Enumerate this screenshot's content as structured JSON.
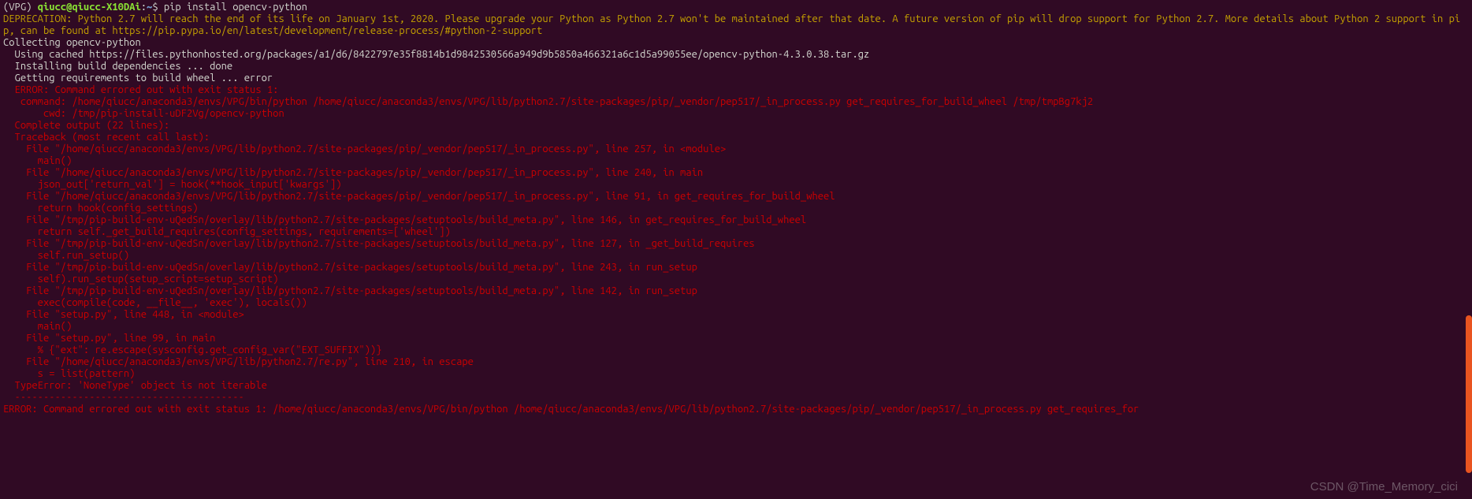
{
  "prompt": {
    "env": "(VPG) ",
    "user": "qiucc",
    "at": "@",
    "host": "qiucc-X10DAi",
    "colon": ":",
    "path": "~",
    "dollar": "$ "
  },
  "command": "pip install opencv-python",
  "deprecation": "DEPRECATION: Python 2.7 will reach the end of its life on January 1st, 2020. Please upgrade your Python as Python 2.7 won't be maintained after that date. A future version of pip will drop support for Python 2.7. More details about Python 2 support in pip, can be found at https://pip.pypa.io/en/latest/development/release-process/#python-2-support",
  "collecting": "Collecting opencv-python",
  "using_cached": "  Using cached https://files.pythonhosted.org/packages/a1/d6/8422797e35f8814b1d9842530566a949d9b5850a466321a6c1d5a99055ee/opencv-python-4.3.0.38.tar.gz",
  "installing_deps": "  Installing build dependencies ... done",
  "getting_reqs": "  Getting requirements to build wheel ... error",
  "err_header": "  ERROR: Command errored out with exit status 1:",
  "err_command": "   command: /home/qiucc/anaconda3/envs/VPG/bin/python /home/qiucc/anaconda3/envs/VPG/lib/python2.7/site-packages/pip/_vendor/pep517/_in_process.py get_requires_for_build_wheel /tmp/tmpBg7kj2",
  "err_cwd": "       cwd: /tmp/pip-install-uDF2Vg/opencv-python",
  "err_output": "  Complete output (22 lines):",
  "traceback_header": "  Traceback (most recent call last):",
  "tb": [
    "    File \"/home/qiucc/anaconda3/envs/VPG/lib/python2.7/site-packages/pip/_vendor/pep517/_in_process.py\", line 257, in <module>",
    "      main()",
    "    File \"/home/qiucc/anaconda3/envs/VPG/lib/python2.7/site-packages/pip/_vendor/pep517/_in_process.py\", line 240, in main",
    "      json_out['return_val'] = hook(**hook_input['kwargs'])",
    "    File \"/home/qiucc/anaconda3/envs/VPG/lib/python2.7/site-packages/pip/_vendor/pep517/_in_process.py\", line 91, in get_requires_for_build_wheel",
    "      return hook(config_settings)",
    "    File \"/tmp/pip-build-env-uQedSn/overlay/lib/python2.7/site-packages/setuptools/build_meta.py\", line 146, in get_requires_for_build_wheel",
    "      return self._get_build_requires(config_settings, requirements=['wheel'])",
    "    File \"/tmp/pip-build-env-uQedSn/overlay/lib/python2.7/site-packages/setuptools/build_meta.py\", line 127, in _get_build_requires",
    "      self.run_setup()",
    "    File \"/tmp/pip-build-env-uQedSn/overlay/lib/python2.7/site-packages/setuptools/build_meta.py\", line 243, in run_setup",
    "      self).run_setup(setup_script=setup_script)",
    "    File \"/tmp/pip-build-env-uQedSn/overlay/lib/python2.7/site-packages/setuptools/build_meta.py\", line 142, in run_setup",
    "      exec(compile(code, __file__, 'exec'), locals())",
    "    File \"setup.py\", line 448, in <module>",
    "      main()",
    "    File \"setup.py\", line 99, in main",
    "      % {\"ext\": re.escape(sysconfig.get_config_var(\"EXT_SUFFIX\"))}",
    "    File \"/home/qiucc/anaconda3/envs/VPG/lib/python2.7/re.py\", line 210, in escape",
    "      s = list(pattern)",
    "  TypeError: 'NoneType' object is not iterable"
  ],
  "dashline": "  ----------------------------------------",
  "err_footer": "ERROR: Command errored out with exit status 1: /home/qiucc/anaconda3/envs/VPG/bin/python /home/qiucc/anaconda3/envs/VPG/lib/python2.7/site-packages/pip/_vendor/pep517/_in_process.py get_requires_for",
  "watermark": "CSDN @Time_Memory_cici"
}
